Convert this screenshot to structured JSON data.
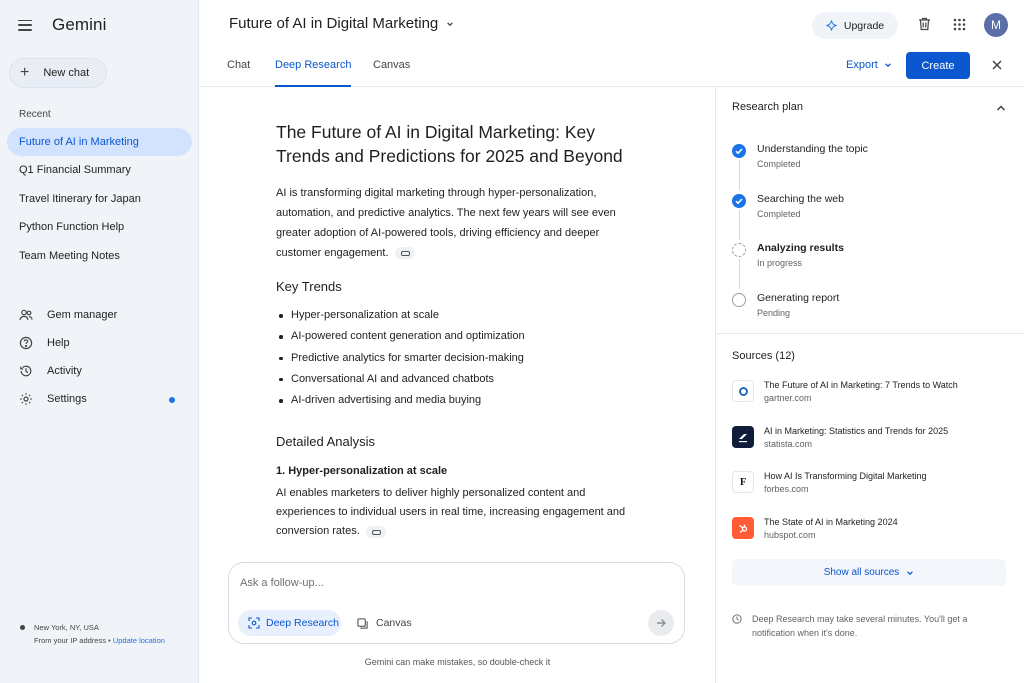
{
  "app": {
    "logo": "Gemini",
    "new_chat": "New chat",
    "recent_label": "Recent",
    "recent": [
      {
        "label": "Future of AI in Marketing",
        "active": true
      },
      {
        "label": "Q1 Financial Summary",
        "active": false
      },
      {
        "label": "Travel Itinerary for Japan",
        "active": false
      },
      {
        "label": "Python Function Help",
        "active": false
      },
      {
        "label": "Team Meeting Notes",
        "active": false
      }
    ],
    "nav": {
      "gem_manager": "Gem manager",
      "help": "Help",
      "activity": "Activity",
      "settings": "Settings"
    },
    "location": {
      "place": "New York, NY, USA",
      "from_ip": "From your IP address",
      "separator": "•",
      "update_link": "Update location"
    }
  },
  "header": {
    "title": "Future of AI in Digital Marketing",
    "upgrade": "Upgrade",
    "avatar_initial": "M"
  },
  "tabs": {
    "chat": "Chat",
    "deep_research": "Deep Research",
    "canvas": "Canvas",
    "export": "Export",
    "create": "Create"
  },
  "article": {
    "title": "The Future of AI in Digital Marketing: Key Trends and Predictions for 2025 and Beyond",
    "intro": "AI is transforming digital marketing through hyper-personalization, automation, and predictive analytics. The next few years will see even greater adoption of AI-powered tools, driving efficiency and deeper customer engagement.",
    "key_trends_heading": "Key Trends",
    "key_trends": [
      "Hyper-personalization at scale",
      "AI-powered content generation and optimization",
      "Predictive analytics for smarter decision-making",
      "Conversational AI and advanced chatbots",
      "AI-driven advertising and media buying"
    ],
    "analysis_heading": "Detailed Analysis",
    "subsection_heading": "1. Hyper-personalization at scale",
    "subsection_text": "AI enables marketers to deliver highly personalized content and experiences to individual users in real time, increasing engagement and conversion rates."
  },
  "followup": {
    "placeholder": "Ask a follow-up...",
    "deep_research": "Deep Research",
    "canvas": "Canvas",
    "disclaimer": "Gemini can make mistakes, so double-check it"
  },
  "research_plan": {
    "heading": "Research plan",
    "steps": [
      {
        "title": "Understanding the topic",
        "status": "Completed",
        "state": "done"
      },
      {
        "title": "Searching the web",
        "status": "Completed",
        "state": "done"
      },
      {
        "title": "Analyzing results",
        "status": "In progress",
        "state": "progress"
      },
      {
        "title": "Generating report",
        "status": "Pending",
        "state": "pending"
      }
    ]
  },
  "sources": {
    "heading": "Sources (12)",
    "items": [
      {
        "title": "The Future of AI in Marketing: 7 Trends to Watch",
        "domain": "gartner.com",
        "logo": "gartner-logo-icon",
        "logo_bg": "#ffffff",
        "logo_fg": "#1a5fb4"
      },
      {
        "title": "AI in Marketing: Statistics and Trends for 2025",
        "domain": "statista.com",
        "logo": "statista-logo-icon",
        "logo_bg": "#0f1d3a",
        "logo_fg": "#ffffff"
      },
      {
        "title": "How AI Is Transforming Digital Marketing",
        "domain": "forbes.com",
        "logo": "forbes-logo-icon",
        "logo_bg": "#ffffff",
        "logo_fg": "#111111",
        "logo_text": "F"
      },
      {
        "title": "The State of AI in Marketing 2024",
        "domain": "hubspot.com",
        "logo": "hubspot-logo-icon",
        "logo_bg": "#ff5c35",
        "logo_fg": "#ffffff"
      }
    ],
    "show_all": "Show all sources",
    "note": "Deep Research may take several minutes. You'll get a notification when it's done."
  },
  "colors": {
    "accent": "#0b57d0",
    "sidebar_bg": "#f0f4f9",
    "active_item_bg": "#d3e3fd",
    "settings_dot": "#1a73e8"
  }
}
